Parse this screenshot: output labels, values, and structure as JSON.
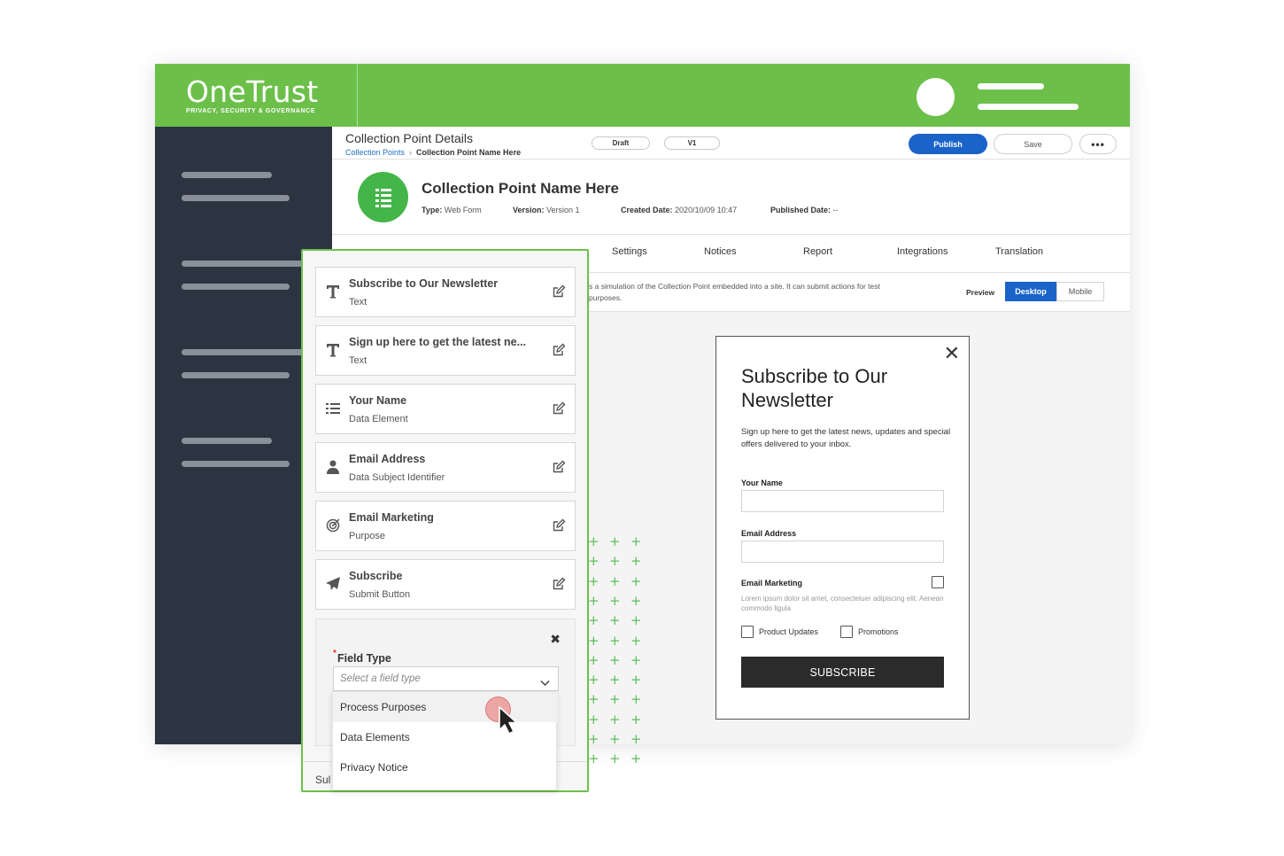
{
  "brand": {
    "name": "OneTrust",
    "tagline": "PRIVACY, SECURITY & GOVERNANCE",
    "green": "#6cc04a",
    "dark": "#2d3441",
    "blue": "#1a63c9"
  },
  "header": {
    "title": "Collection Point Details",
    "breadcrumb": {
      "parent": "Collection Points",
      "current": "Collection Point Name Here"
    },
    "status_pill": "Draft",
    "version_pill": "V1",
    "publish_label": "Publish",
    "save_label": "Save",
    "more_label": "•••"
  },
  "collection_point": {
    "name": "Collection Point Name Here",
    "icon": "list-icon",
    "meta": {
      "type_label": "Type:",
      "type_value": "Web Form",
      "version_label": "Version:",
      "version_value": "Version 1",
      "created_label": "Created Date:",
      "created_value": "2020/10/09 10:47",
      "published_label": "Published Date:",
      "published_value": "--"
    }
  },
  "tabs": [
    "Settings",
    "Notices",
    "Report",
    "Integrations",
    "Translation"
  ],
  "preview": {
    "description": "s a simulation of the Collection Point embedded into a site. It can submit actions for test purposes.",
    "label": "Preview",
    "options": [
      "Desktop",
      "Mobile"
    ],
    "selected": "Desktop"
  },
  "newsletter_form": {
    "close": "✕",
    "title": "Subscribe to Our Newsletter",
    "subtitle": "Sign up here to get the latest news, updates and special offers delivered to your inbox.",
    "fields": [
      {
        "label": "Your Name",
        "value": ""
      },
      {
        "label": "Email Address",
        "value": ""
      }
    ],
    "email_marketing_label": "Email Marketing",
    "email_marketing_checked": false,
    "lorem": "Lorem ipsum dolor sit amet, consectetuer adipiscing elit. Aenean commodo ligula",
    "options": [
      {
        "label": "Product Updates",
        "checked": false
      },
      {
        "label": "Promotions",
        "checked": false
      }
    ],
    "submit_label": "SUBSCRIBE"
  },
  "builder": {
    "cards": [
      {
        "title": "Subscribe to Our Newsletter",
        "subtitle": "Text",
        "icon": "text-t-icon"
      },
      {
        "title": "Sign up here to get the latest ne...",
        "subtitle": "Text",
        "icon": "text-t-icon"
      },
      {
        "title": "Your Name",
        "subtitle": "Data Element",
        "icon": "list-icon"
      },
      {
        "title": "Email Address",
        "subtitle": "Data Subject Identifier",
        "icon": "user-icon"
      },
      {
        "title": "Email Marketing",
        "subtitle": "Purpose",
        "icon": "target-icon"
      },
      {
        "title": "Subscribe",
        "subtitle": "Submit Button",
        "icon": "paper-plane-icon"
      }
    ],
    "field_type": {
      "required_mark": "*",
      "label": "Field Type",
      "close": "✖",
      "placeholder": "Select a field type",
      "options": [
        "Process Purposes",
        "Data Elements",
        "Privacy Notice"
      ],
      "hovered": "Process Purposes"
    },
    "bottom_partial": "Sul"
  }
}
